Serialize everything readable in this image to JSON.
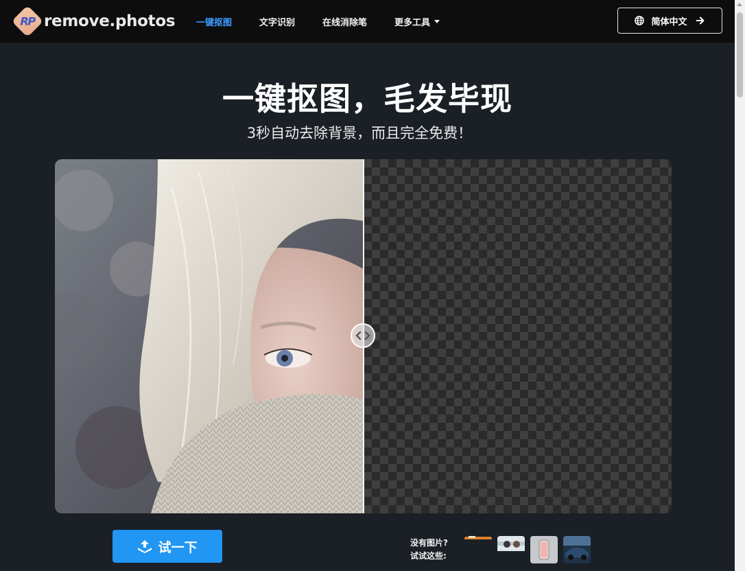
{
  "navbar": {
    "logo_mark": "RP",
    "logo_text": "remove.photos",
    "links": [
      {
        "label": "一键抠图",
        "active": true
      },
      {
        "label": "文字识别",
        "active": false
      },
      {
        "label": "在线消除笔",
        "active": false
      },
      {
        "label": "更多工具",
        "active": false,
        "dropdown": true
      }
    ],
    "language_button": "简体中文"
  },
  "hero": {
    "title": "一键抠图，毛发毕现",
    "subtitle": "3秒自动去除背景，而且完全免费！"
  },
  "compare": {
    "left_icon": "chevron-left-icon",
    "right_icon": "chevron-right-icon"
  },
  "actions": {
    "try_button": "试一下",
    "no_image_line1": "没有图片?",
    "no_image_line2": "试试这些:"
  },
  "colors": {
    "accent": "#2196f3",
    "active_link": "#3d9bff",
    "background": "#1b1f26",
    "navbar": "#0d0d0e"
  }
}
